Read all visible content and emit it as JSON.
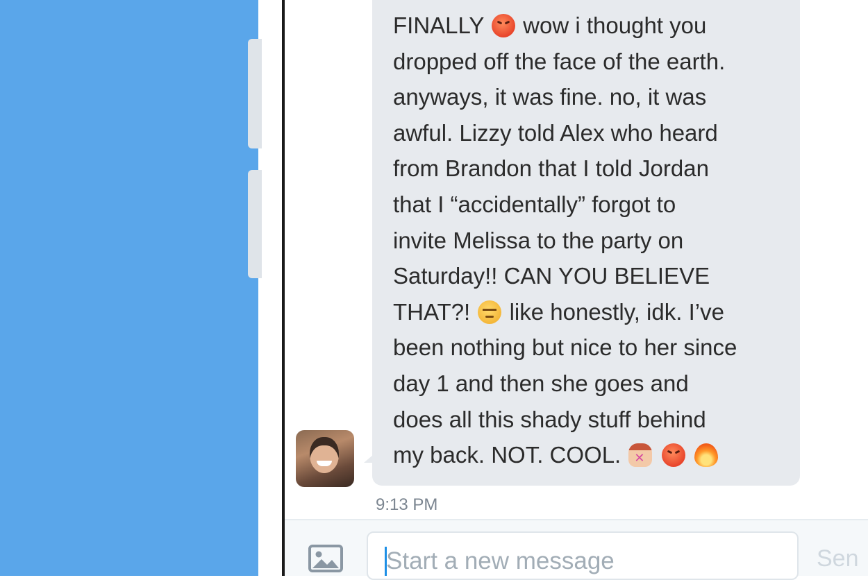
{
  "message": {
    "lines": [
      {
        "parts": [
          {
            "text": "FINALLY "
          },
          {
            "emoji": "angry-face-emoji"
          },
          {
            "text": " wow i thought you"
          }
        ]
      },
      {
        "parts": [
          {
            "text": "dropped off the face of the earth."
          }
        ]
      },
      {
        "parts": [
          {
            "text": "anyways, it was fine. no, it was"
          }
        ]
      },
      {
        "parts": [
          {
            "text": "awful. Lizzy told Alex who heard"
          }
        ]
      },
      {
        "parts": [
          {
            "text": "from Brandon that I told Jordan"
          }
        ]
      },
      {
        "parts": [
          {
            "text": "that I “accidentally” forgot to"
          }
        ]
      },
      {
        "parts": [
          {
            "text": "invite Melissa to the party on"
          }
        ]
      },
      {
        "parts": [
          {
            "text": "Saturday!! CAN YOU BELIEVE"
          }
        ]
      },
      {
        "parts": [
          {
            "text": "THAT?! "
          },
          {
            "emoji": "unamused-face-emoji"
          },
          {
            "text": " like honestly, idk. I’ve"
          }
        ]
      },
      {
        "parts": [
          {
            "text": "been nothing but nice to her since"
          }
        ]
      },
      {
        "parts": [
          {
            "text": "day 1 and then she goes and"
          }
        ]
      },
      {
        "parts": [
          {
            "text": "does all this shady stuff behind"
          }
        ]
      },
      {
        "parts": [
          {
            "text": "my back. NOT. COOL. "
          },
          {
            "emoji": "no-gesture-emoji"
          },
          {
            "text": " "
          },
          {
            "emoji": "angry-face-emoji"
          },
          {
            "text": " "
          },
          {
            "emoji": "fire-emoji"
          }
        ]
      }
    ],
    "timestamp": "9:13 PM"
  },
  "composer": {
    "placeholder": "Start a new message",
    "send_label": "Sen",
    "media_icon": "image-icon"
  },
  "colors": {
    "left_panel": "#5aa6ea",
    "bubble": "#e7eaee",
    "caret": "#1d8fe6"
  }
}
